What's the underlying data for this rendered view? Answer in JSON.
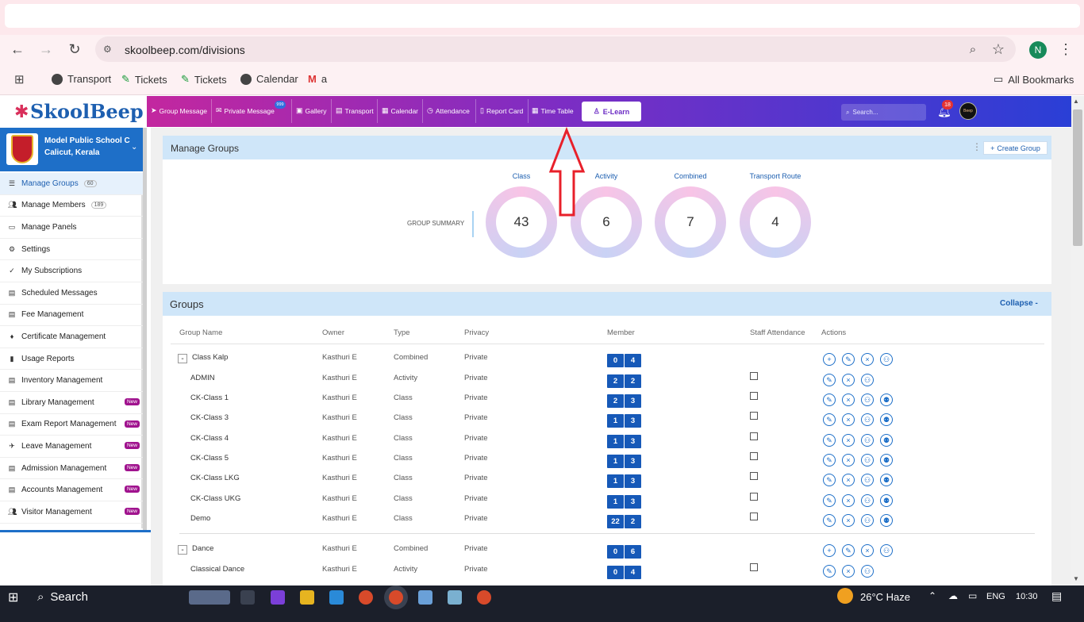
{
  "browser": {
    "url": "skoolbeep.com/divisions",
    "profile_initial": "N",
    "bookmarks": [
      {
        "label": "Transport"
      },
      {
        "label": "Tickets"
      },
      {
        "label": "Tickets"
      },
      {
        "label": "Calendar"
      },
      {
        "label": "a"
      }
    ],
    "all_bookmarks": "All Bookmarks"
  },
  "app": {
    "logo": "SkoolBeep",
    "nav": [
      "Group Message",
      "Private Message",
      "Gallery",
      "Transport",
      "Calendar",
      "Attendance",
      "Report Card",
      "Time Table"
    ],
    "private_badge": "999",
    "elearn": "E-Learn",
    "search_placeholder": "Search...",
    "notif_count": "18",
    "user_avatar_text": "Beep"
  },
  "school": {
    "name": "Model Public School C",
    "location": "Calicut, Kerala"
  },
  "sidebar": [
    {
      "label": "Manage Groups",
      "count": "60",
      "active": true
    },
    {
      "label": "Manage Members",
      "count": "189"
    },
    {
      "label": "Manage Panels"
    },
    {
      "label": "Settings"
    },
    {
      "label": "My Subscriptions"
    },
    {
      "label": "Scheduled Messages"
    },
    {
      "label": "Fee Management"
    },
    {
      "label": "Certificate Management"
    },
    {
      "label": "Usage Reports"
    },
    {
      "label": "Inventory Management"
    },
    {
      "label": "Library Management",
      "new": "New"
    },
    {
      "label": "Exam Report Management",
      "new": "New"
    },
    {
      "label": "Leave Management",
      "new": "New"
    },
    {
      "label": "Admission Management",
      "new": "New"
    },
    {
      "label": "Accounts Management",
      "new": "New"
    },
    {
      "label": "Visitor Management",
      "new": "New"
    }
  ],
  "manage_groups": {
    "title": "Manage Groups",
    "create": "Create Group",
    "summary_label": "GROUP SUMMARY",
    "summary": [
      {
        "label": "Class",
        "value": "43"
      },
      {
        "label": "Activity",
        "value": "6"
      },
      {
        "label": "Combined",
        "value": "7"
      },
      {
        "label": "Transport Route",
        "value": "4"
      }
    ]
  },
  "groups": {
    "title": "Groups",
    "collapse": "Collapse -",
    "headers": [
      "Group Name",
      "Owner",
      "Type",
      "Privacy",
      "Member",
      "Staff Attendance",
      "Actions"
    ],
    "rows": [
      {
        "name": "Class Kalp",
        "owner": "Kasthuri E",
        "type": "Combined",
        "privacy": "Private",
        "m1": "0",
        "m2": "4",
        "parent": true,
        "expander": "-"
      },
      {
        "name": "ADMIN",
        "owner": "Kasthuri E",
        "type": "Activity",
        "privacy": "Private",
        "m1": "2",
        "m2": "2"
      },
      {
        "name": "CK-Class 1",
        "owner": "Kasthuri E",
        "type": "Class",
        "privacy": "Private",
        "m1": "2",
        "m2": "3"
      },
      {
        "name": "CK-Class 3",
        "owner": "Kasthuri E",
        "type": "Class",
        "privacy": "Private",
        "m1": "1",
        "m2": "3"
      },
      {
        "name": "CK-Class 4",
        "owner": "Kasthuri E",
        "type": "Class",
        "privacy": "Private",
        "m1": "1",
        "m2": "3"
      },
      {
        "name": "CK-Class 5",
        "owner": "Kasthuri E",
        "type": "Class",
        "privacy": "Private",
        "m1": "1",
        "m2": "3"
      },
      {
        "name": "CK-Class LKG",
        "owner": "Kasthuri E",
        "type": "Class",
        "privacy": "Private",
        "m1": "1",
        "m2": "3"
      },
      {
        "name": "CK-Class UKG",
        "owner": "Kasthuri E",
        "type": "Class",
        "privacy": "Private",
        "m1": "1",
        "m2": "3"
      },
      {
        "name": "Demo",
        "owner": "Kasthuri E",
        "type": "Class",
        "privacy": "Private",
        "m1": "22",
        "m2": "2"
      },
      {
        "name": "Dance",
        "owner": "Kasthuri E",
        "type": "Combined",
        "privacy": "Private",
        "m1": "0",
        "m2": "6",
        "parent": true,
        "expander": "-"
      },
      {
        "name": "Classical Dance",
        "owner": "Kasthuri E",
        "type": "Activity",
        "privacy": "Private",
        "m1": "0",
        "m2": "4"
      }
    ]
  },
  "taskbar": {
    "search": "Search",
    "weather": "26°C  Haze",
    "lang": "ENG",
    "time": "10:30"
  }
}
